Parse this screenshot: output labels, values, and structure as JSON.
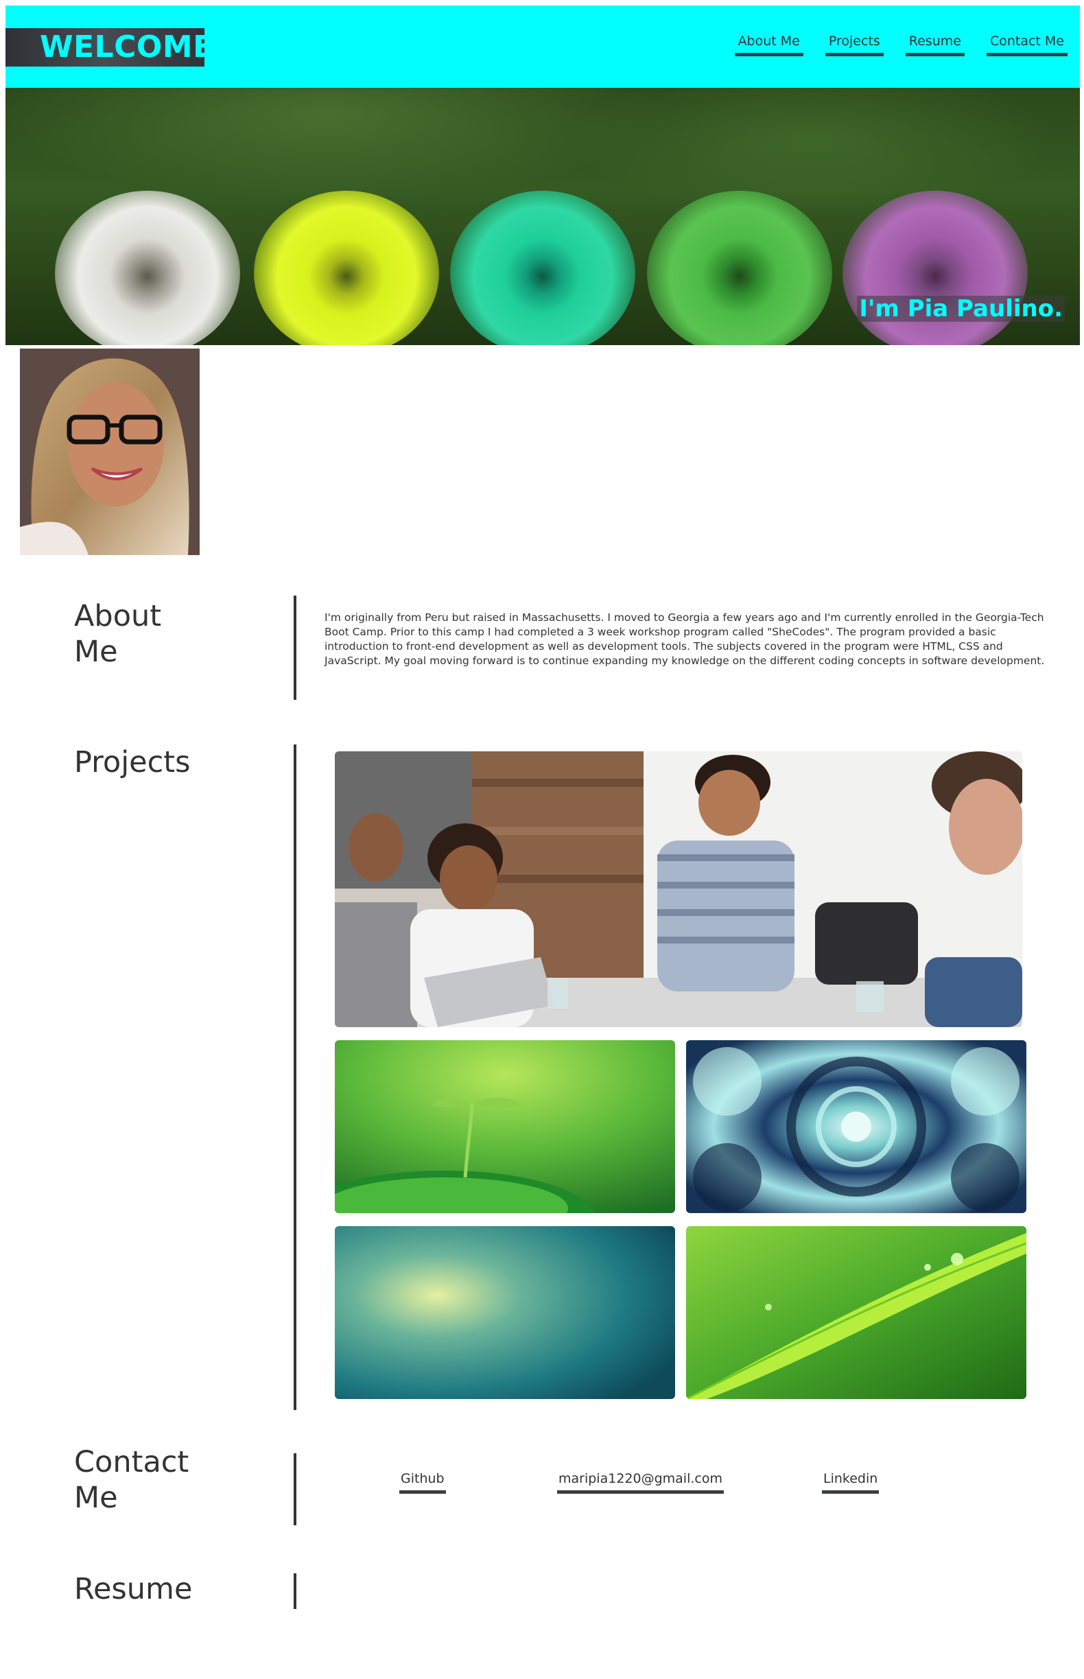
{
  "header": {
    "brand": "WELCOME!",
    "nav": [
      {
        "label": "About Me"
      },
      {
        "label": "Projects"
      },
      {
        "label": "Resume"
      },
      {
        "label": "Contact Me"
      }
    ],
    "background_color": "#00ffff"
  },
  "hero": {
    "name_banner": "I'm Pia Paulino.",
    "puff_colors": [
      "#e6e6e0",
      "#d9f21a",
      "#1fcf98",
      "#4cba46",
      "#a05aa8"
    ]
  },
  "avatar": {
    "icon": "profile-photo"
  },
  "about": {
    "title": "About Me",
    "text": "I'm originally from Peru but raised in Massachusetts. I moved to Georgia a few years ago and I'm currently enrolled in the Georgia-Tech Boot Camp. Prior to this camp I had completed a 3 week workshop program called \"SheCodes\". The program provided a basic introduction to front-end development as well as development tools. The subjects covered in the program were HTML, CSS and JavaScript. My goal moving forward is to continue expanding my knowledge on the different coding concepts in software development."
  },
  "projects": {
    "title": "Projects",
    "images": [
      {
        "icon": "team-meeting-photo"
      },
      {
        "icon": "seedling-photo"
      },
      {
        "icon": "kaleidoscope-photo"
      },
      {
        "icon": "teal-gradient-photo"
      },
      {
        "icon": "grass-blade-photo"
      }
    ]
  },
  "contact": {
    "title": "Contact Me",
    "links": [
      {
        "label": "Github"
      },
      {
        "label": "maripia1220@gmail.com"
      },
      {
        "label": "Linkedin"
      }
    ]
  },
  "resume": {
    "title": "Resume"
  }
}
